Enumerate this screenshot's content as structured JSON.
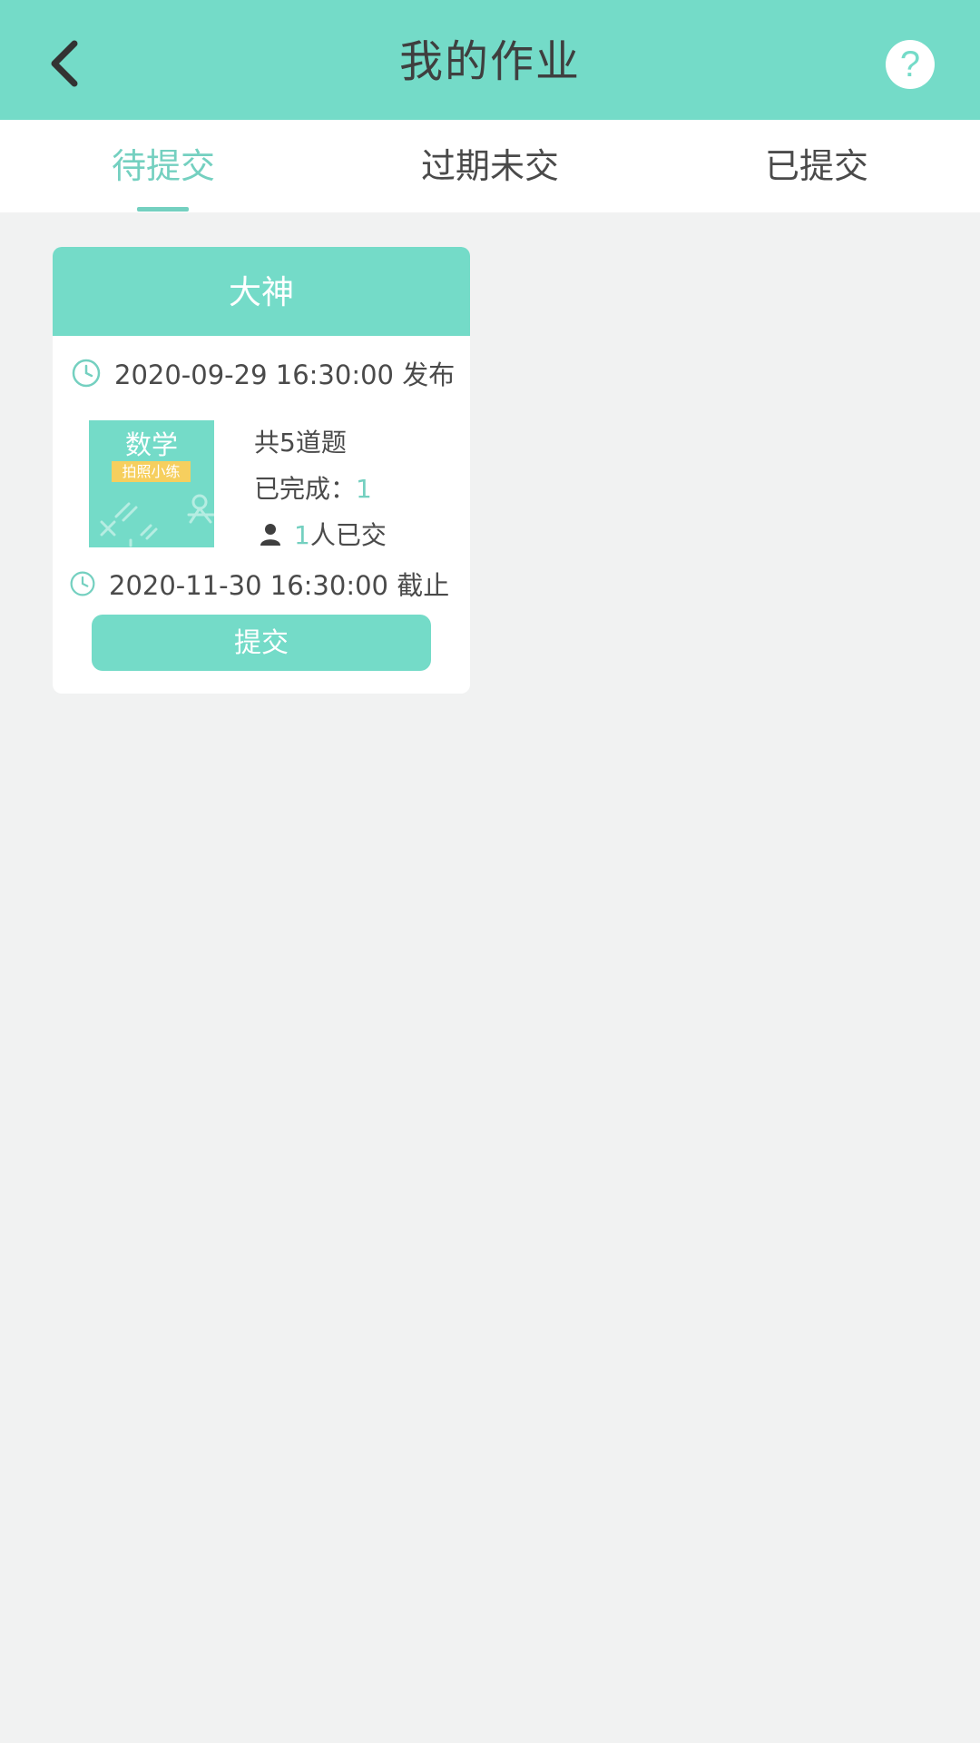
{
  "header": {
    "title": "我的作业",
    "back_icon": "chevron-left-icon",
    "help_icon": "question-circle-icon",
    "help_glyph": "?"
  },
  "tabs": [
    {
      "label": "待提交",
      "active": true
    },
    {
      "label": "过期未交",
      "active": false
    },
    {
      "label": "已提交",
      "active": false
    }
  ],
  "card": {
    "title": "大神",
    "publish": "2020-09-29 16:30:00 发布",
    "thumbnail": {
      "subject": "数学",
      "tag": "拍照小练"
    },
    "question_count": "共5道题",
    "completed_label": "已完成：",
    "completed_value": "1",
    "submitted_count": "1",
    "submitted_label": "人已交",
    "deadline": "2020-11-30 16:30:00 截止",
    "submit_label": "提交"
  },
  "colors": {
    "accent": "#74dbc8",
    "accent_text": "#74d0c0",
    "background": "#f1f2f2",
    "tag": "#f6cf5e"
  }
}
